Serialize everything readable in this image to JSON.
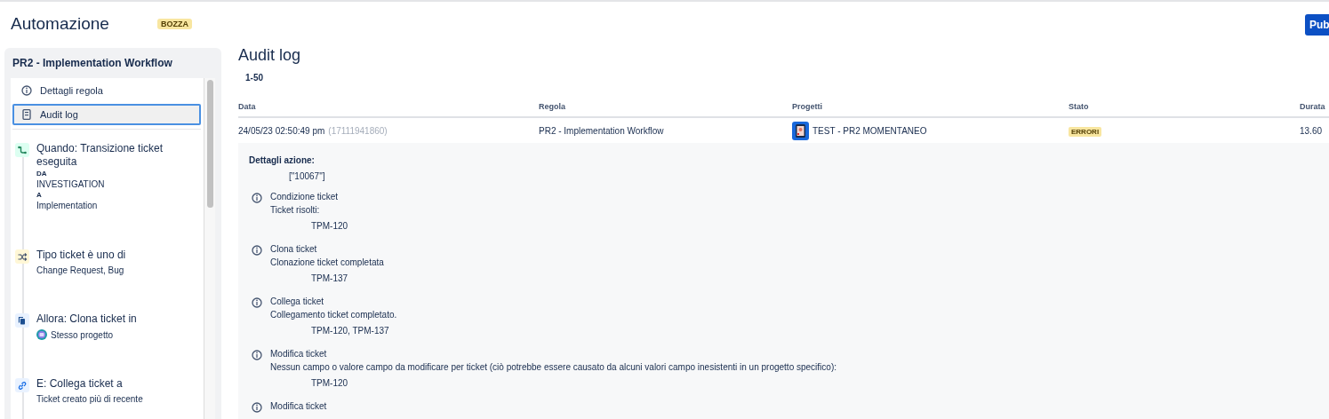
{
  "header": {
    "title": "Automazione",
    "badge": "BOZZA",
    "publish_button": "Pub"
  },
  "sidebar": {
    "title": "PR2 - Implementation Workflow",
    "nav": [
      {
        "label": "Dettagli regola",
        "kind": "info",
        "selected": false
      },
      {
        "label": "Audit log",
        "kind": "log",
        "selected": true
      }
    ],
    "steps": [
      {
        "kind": "trigger",
        "title": "Quando: Transizione ticket eseguita",
        "lines": [
          {
            "text": "DA",
            "emphasis": true
          },
          {
            "text": "INVESTIGATION",
            "emphasis": false
          },
          {
            "text": "A",
            "emphasis": true
          },
          {
            "text": "Implementation",
            "emphasis": false
          }
        ]
      },
      {
        "kind": "condition",
        "title": "Tipo ticket è uno di",
        "subtitle": "Change Request, Bug"
      },
      {
        "kind": "clone",
        "title": "Allora: Clona ticket in",
        "subtitle": "Stesso progetto",
        "subtitle_avatar": true
      },
      {
        "kind": "link",
        "title": "E: Collega ticket a",
        "subtitle": "Ticket creato più di recente"
      }
    ]
  },
  "main": {
    "title": "Audit log",
    "range": "1-50",
    "table": {
      "columns": [
        "Data",
        "Regola",
        "Progetti",
        "Stato",
        "Durata"
      ],
      "rows": [
        {
          "date": "24/05/23 02:50:49 pm",
          "id": "(17111941860)",
          "rule": "PR2 - Implementation Workflow",
          "project": "TEST - PR2 MOMENTANEO",
          "status": "ERRORI",
          "duration": "13.60"
        }
      ]
    },
    "details": {
      "heading": "Dettagli azione:",
      "value": "[\"10067\"]",
      "entries": [
        {
          "title": "Condizione ticket",
          "message": "Ticket risolti:",
          "tickets": "TPM-120"
        },
        {
          "title": "Clona ticket",
          "message": "Clonazione ticket completata",
          "tickets": "TPM-137"
        },
        {
          "title": "Collega ticket",
          "message": "Collegamento ticket completato.",
          "tickets": "TPM-120, TPM-137"
        },
        {
          "title": "Modifica ticket",
          "message": "Nessun campo o valore campo da modificare per ticket (ciò potrebbe essere causato da alcuni valori campo inesistenti in un progetto specifico):",
          "tickets": "TPM-120"
        },
        {
          "title": "Modifica ticket"
        }
      ]
    }
  }
}
